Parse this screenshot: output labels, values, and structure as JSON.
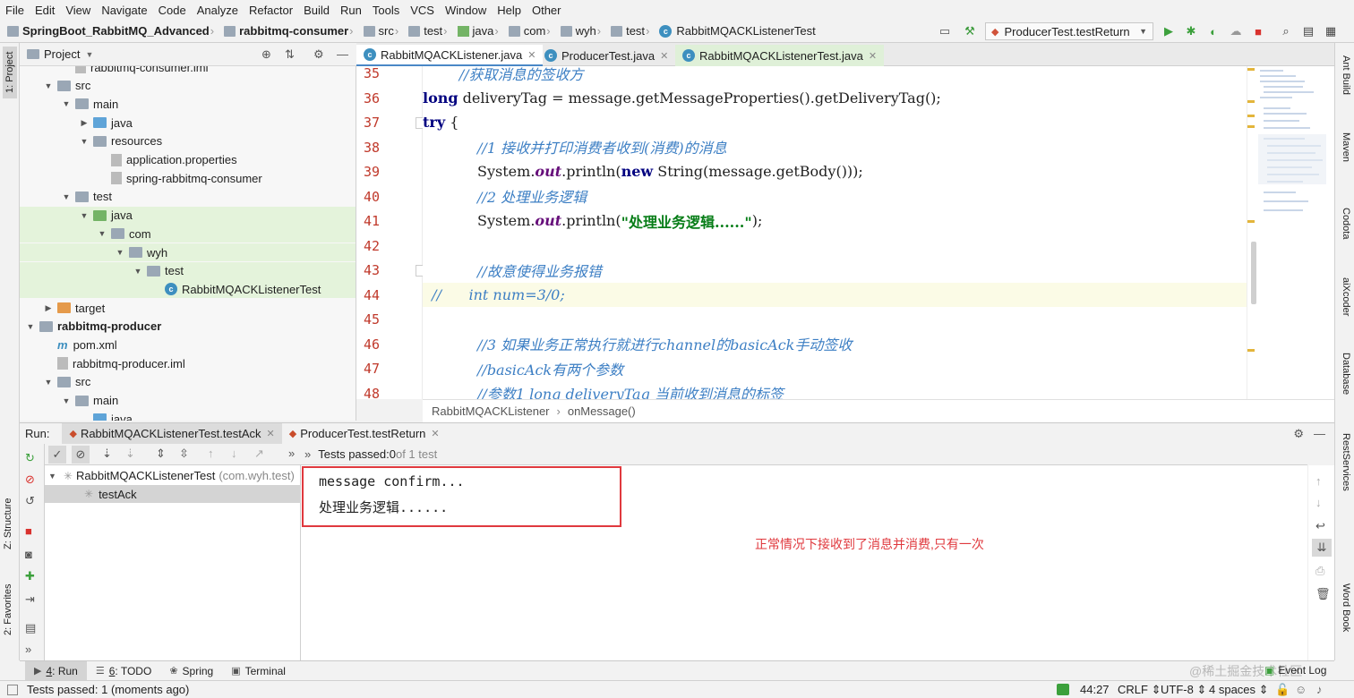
{
  "menu": [
    "File",
    "Edit",
    "View",
    "Navigate",
    "Code",
    "Analyze",
    "Refactor",
    "Build",
    "Run",
    "Tools",
    "VCS",
    "Window",
    "Help",
    "Other"
  ],
  "breadcrumb": [
    "SpringBoot_RabbitMQ_Advanced",
    "rabbitmq-consumer",
    "src",
    "test",
    "java",
    "com",
    "wyh",
    "test",
    "RabbitMQACKListenerTest"
  ],
  "run_config": "ProducerTest.testReturn",
  "project": {
    "title": "Project"
  },
  "tree": [
    {
      "label": "rabbitmq-consumer.iml",
      "indent": 3,
      "icon": "file",
      "arrow": ""
    },
    {
      "label": "src",
      "indent": 2,
      "icon": "folder-gray",
      "arrow": "down"
    },
    {
      "label": "main",
      "indent": 3,
      "icon": "folder-gray",
      "arrow": "down"
    },
    {
      "label": "java",
      "indent": 4,
      "icon": "folder-blue",
      "arrow": "right"
    },
    {
      "label": "resources",
      "indent": 4,
      "icon": "folder-gray",
      "arrow": "down"
    },
    {
      "label": "application.properties",
      "indent": 5,
      "icon": "file",
      "arrow": ""
    },
    {
      "label": "spring-rabbitmq-consumer",
      "indent": 5,
      "icon": "file",
      "arrow": ""
    },
    {
      "label": "test",
      "indent": 3,
      "icon": "folder-gray",
      "arrow": "down"
    },
    {
      "label": "java",
      "indent": 4,
      "icon": "folder-green",
      "arrow": "down",
      "hl": true
    },
    {
      "label": "com",
      "indent": 5,
      "icon": "folder-gray",
      "arrow": "down",
      "hl": true
    },
    {
      "label": "wyh",
      "indent": 6,
      "icon": "folder-gray",
      "arrow": "down",
      "hl": true
    },
    {
      "label": "test",
      "indent": 7,
      "icon": "folder-gray",
      "arrow": "down",
      "hl": true
    },
    {
      "label": "RabbitMQACKListenerTest",
      "indent": 8,
      "icon": "class",
      "arrow": "",
      "hl": true
    },
    {
      "label": "target",
      "indent": 2,
      "icon": "folder-orange",
      "arrow": "right"
    },
    {
      "label": "rabbitmq-producer",
      "indent": 1,
      "icon": "folder-gray",
      "arrow": "down",
      "bold": true
    },
    {
      "label": "pom.xml",
      "indent": 2,
      "icon": "maven",
      "arrow": ""
    },
    {
      "label": "rabbitmq-producer.iml",
      "indent": 2,
      "icon": "file",
      "arrow": ""
    },
    {
      "label": "src",
      "indent": 2,
      "icon": "folder-gray",
      "arrow": "down"
    },
    {
      "label": "main",
      "indent": 3,
      "icon": "folder-gray",
      "arrow": "down"
    },
    {
      "label": "java",
      "indent": 4,
      "icon": "folder-blue",
      "arrow": ""
    }
  ],
  "tabs": [
    "RabbitMQACKListener.java",
    "ProducerTest.java",
    "RabbitMQACKListenerTest.java"
  ],
  "code": [
    {
      "n": "35",
      "t": "        //获取消息的签收方",
      "k": "cm"
    },
    {
      "n": "36",
      "t": "        long deliveryTag = message.getMessageProperties().getDeliveryTag();",
      "k": "kw1"
    },
    {
      "n": "37",
      "t": "        try {",
      "k": "kw2"
    },
    {
      "n": "38",
      "t": "            //1 接收并打印消费者收到(消费)的消息",
      "k": "cm"
    },
    {
      "n": "39",
      "t": "            System.out.println(new String(message.getBody()));",
      "k": "sys1"
    },
    {
      "n": "40",
      "t": "            //2 处理业务逻辑",
      "k": "cm"
    },
    {
      "n": "41",
      "t": "            System.out.println(\"处理业务逻辑......\");",
      "k": "sys2"
    },
    {
      "n": "42",
      "t": "",
      "k": ""
    },
    {
      "n": "43",
      "t": "            //故意使得业务报错",
      "k": "cm"
    },
    {
      "n": "44",
      "t": "  //      int num=3/0;",
      "k": "cm"
    },
    {
      "n": "45",
      "t": "",
      "k": ""
    },
    {
      "n": "46",
      "t": "            //3 如果业务正常执行就进行channel的basicAck手动签收",
      "k": "cm"
    },
    {
      "n": "47",
      "t": "            //basicAck有两个参数",
      "k": "cm"
    },
    {
      "n": "48",
      "t": "            //参数1 long deliveryTag 当前收到消息的标签",
      "k": "cm"
    }
  ],
  "code_crumbs": [
    "RabbitMQACKListener",
    "onMessage()"
  ],
  "run": {
    "label": "Run:",
    "tabs": [
      "RabbitMQACKListenerTest.testAck",
      "ProducerTest.testReturn"
    ],
    "tests_passed_prefix": "Tests passed: ",
    "tests_passed_count": "0",
    "tests_passed_suffix": " of 1 test",
    "tree_root": "RabbitMQACKListenerTest",
    "tree_root_pkg": "(com.wyh.test)",
    "tree_child": "testAck",
    "console": [
      "message confirm...",
      "处理业务逻辑......"
    ],
    "note": "正常情况下接收到了消息并消费,只有一次"
  },
  "bottom_tabs": [
    {
      "key": "4",
      "label": ": Run"
    },
    {
      "key": "6",
      "label": ": TODO"
    },
    {
      "key": "",
      "label": "Spring"
    },
    {
      "key": "",
      "label": "Terminal"
    }
  ],
  "event_log": "Event Log",
  "watermark": "@稀土掘金技术社区",
  "status": {
    "message": "Tests passed: 1 (moments ago)",
    "position": "44:27",
    "line_sep": "CRLF",
    "encoding": "UTF-8",
    "indent": "4 spaces"
  },
  "side_left": [
    "1: Project",
    "Z: Structure",
    "2: Favorites"
  ],
  "side_right": [
    "Ant Build",
    "Maven",
    "Codota",
    "aiXcoder",
    "Database",
    "RestServices",
    "Word Book"
  ]
}
